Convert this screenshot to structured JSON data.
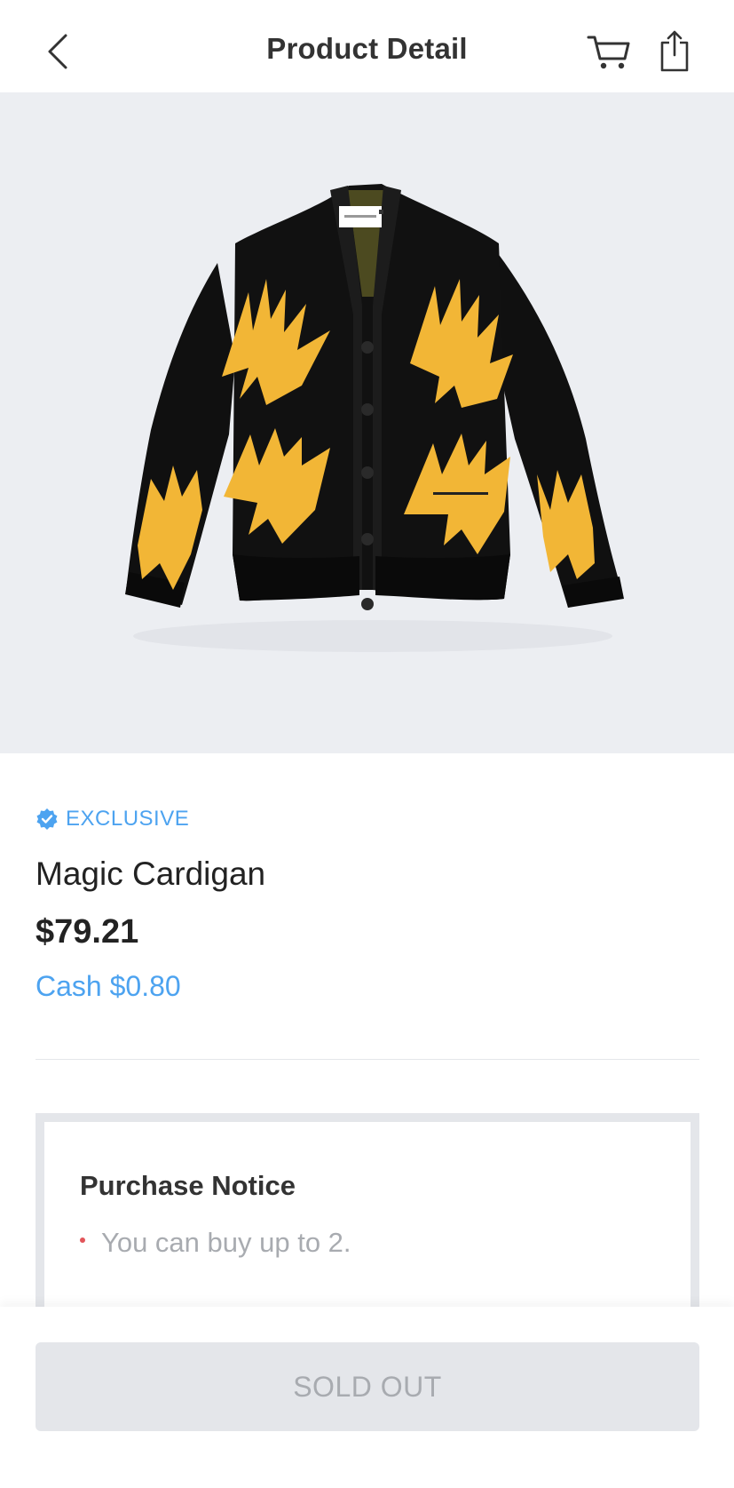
{
  "header": {
    "title": "Product Detail",
    "back_icon": "chevron-left-icon",
    "cart_icon": "cart-icon",
    "share_icon": "share-icon"
  },
  "product": {
    "image": "cardigan-image",
    "badge": "EXCLUSIVE",
    "badge_icon": "verified-badge-icon",
    "name": "Magic Cardigan",
    "price": "$79.21",
    "cashback": "Cash $0.80"
  },
  "notice": {
    "title": "Purchase Notice",
    "items": [
      "You can buy up to 2."
    ]
  },
  "footer": {
    "button_label": "SOLD OUT"
  },
  "colors": {
    "accent": "#4da3f0",
    "bullet": "#e2555a",
    "disabled_bg": "#e4e6ea",
    "disabled_text": "#a8abb0",
    "image_bg": "#eceef2"
  }
}
